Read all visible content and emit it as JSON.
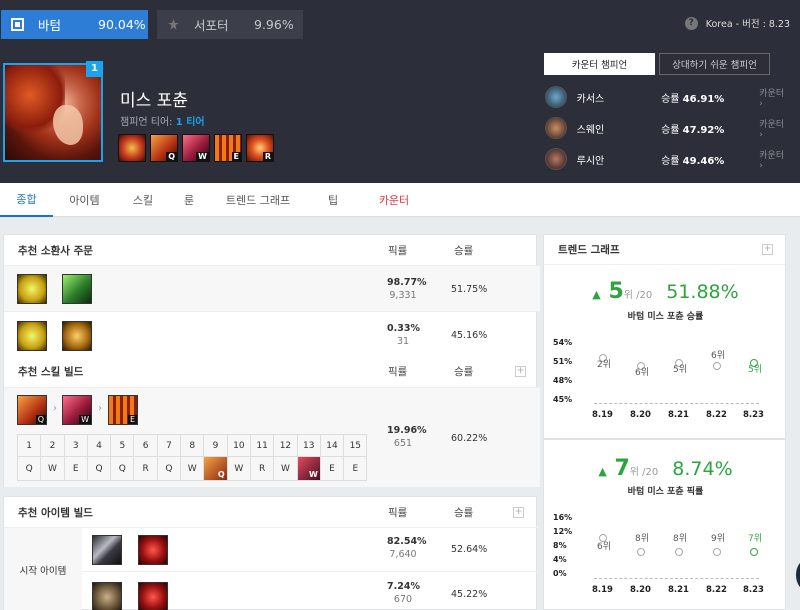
{
  "header": {
    "positions": [
      {
        "name": "바텀",
        "pct": "90.04%"
      },
      {
        "name": "서포터",
        "pct": "9.96%"
      }
    ],
    "help": "?",
    "region_version": "Korea - 버전 : 8.23",
    "champion": {
      "level_badge": "1",
      "name": "미스 포츈",
      "tier_label": "챔피언 티어:",
      "tier_value": "1 티어",
      "skill_keys": [
        "",
        "Q",
        "W",
        "E",
        "R"
      ]
    },
    "counter_tabs": [
      "카운터 챔피언",
      "상대하기 쉬운 챔피언"
    ],
    "counters": [
      {
        "name": "카서스",
        "winrate_label": "승률",
        "winrate": "46.91%",
        "link": "카운터"
      },
      {
        "name": "스웨인",
        "winrate_label": "승률",
        "winrate": "47.92%",
        "link": "카운터"
      },
      {
        "name": "루시안",
        "winrate_label": "승률",
        "winrate": "49.46%",
        "link": "카운터"
      }
    ]
  },
  "tabs": [
    "종합",
    "아이템",
    "스킬",
    "룬",
    "트렌드 그래프",
    "팁",
    "카운터"
  ],
  "spells": {
    "title": "추천 소환사 주문",
    "col_pick": "픽률",
    "col_win": "승률",
    "rows": [
      {
        "pick": "98.77%",
        "games": "9,331",
        "win": "51.75%"
      },
      {
        "pick": "0.33%",
        "games": "31",
        "win": "45.16%"
      }
    ]
  },
  "skill_build": {
    "title": "추천 스킬 빌드",
    "col_pick": "픽률",
    "col_win": "승률",
    "order_keys": [
      "Q",
      "W",
      "E"
    ],
    "pick": "19.96%",
    "games": "651",
    "win": "60.22%",
    "levels": [
      "1",
      "2",
      "3",
      "4",
      "5",
      "6",
      "7",
      "8",
      "9",
      "10",
      "11",
      "12",
      "13",
      "14",
      "15"
    ],
    "sequence": [
      "Q",
      "W",
      "E",
      "Q",
      "Q",
      "R",
      "Q",
      "W",
      "Q",
      "W",
      "R",
      "W",
      "W",
      "E",
      "E"
    ]
  },
  "items": {
    "title": "추천 아이템 빌드",
    "col_pick": "픽률",
    "col_win": "승률",
    "group_label": "시작 아이템",
    "rows": [
      {
        "pick": "82.54%",
        "games": "7,640",
        "win": "52.64%"
      },
      {
        "pick": "7.24%",
        "games": "670",
        "win": "45.22%"
      }
    ]
  },
  "trend": {
    "title": "트렌드 그래프",
    "charts": [
      {
        "rank": "5",
        "rank_suffix": "위 /20",
        "value": "51.88%",
        "subtitle": "바텀 미스 포츈 승률",
        "yticks": [
          "54%",
          "51%",
          "48%",
          "45%"
        ],
        "x": [
          "8.19",
          "8.20",
          "8.21",
          "8.22",
          "8.23"
        ],
        "ranks": [
          "2위",
          "6위",
          "5위",
          "6위",
          "5위"
        ]
      },
      {
        "rank": "7",
        "rank_suffix": "위 /20",
        "value": "8.74%",
        "subtitle": "바텀 미스 포츈 픽률",
        "yticks": [
          "16%",
          "12%",
          "8%",
          "4%",
          "0%"
        ],
        "x": [
          "8.19",
          "8.20",
          "8.21",
          "8.22",
          "8.23"
        ],
        "ranks": [
          "6위",
          "8위",
          "8위",
          "9위",
          "7위"
        ]
      }
    ]
  },
  "colors": {
    "accent": "#2d7cd6",
    "header_bg": "#2c2f39",
    "green": "#2ca53d",
    "red": "#e0383e"
  }
}
